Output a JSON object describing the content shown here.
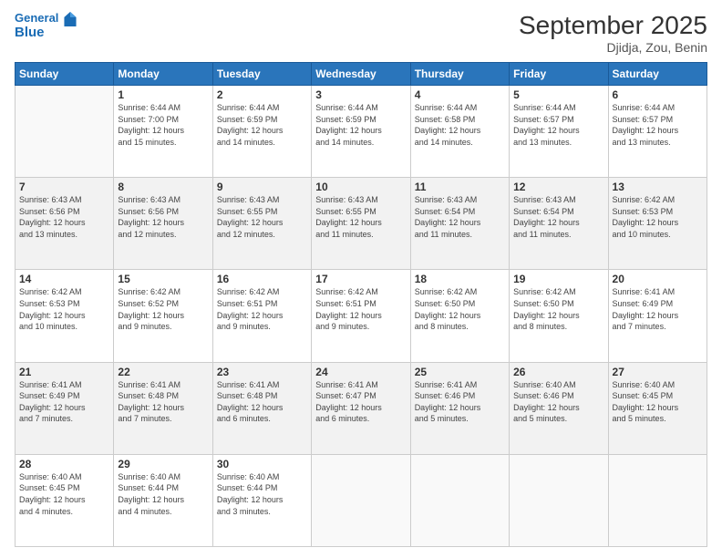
{
  "header": {
    "logo_line1": "General",
    "logo_line2": "Blue",
    "month_title": "September 2025",
    "location": "Djidja, Zou, Benin"
  },
  "weekdays": [
    "Sunday",
    "Monday",
    "Tuesday",
    "Wednesday",
    "Thursday",
    "Friday",
    "Saturday"
  ],
  "weeks": [
    [
      {
        "day": "",
        "info": ""
      },
      {
        "day": "1",
        "info": "Sunrise: 6:44 AM\nSunset: 7:00 PM\nDaylight: 12 hours\nand 15 minutes."
      },
      {
        "day": "2",
        "info": "Sunrise: 6:44 AM\nSunset: 6:59 PM\nDaylight: 12 hours\nand 14 minutes."
      },
      {
        "day": "3",
        "info": "Sunrise: 6:44 AM\nSunset: 6:59 PM\nDaylight: 12 hours\nand 14 minutes."
      },
      {
        "day": "4",
        "info": "Sunrise: 6:44 AM\nSunset: 6:58 PM\nDaylight: 12 hours\nand 14 minutes."
      },
      {
        "day": "5",
        "info": "Sunrise: 6:44 AM\nSunset: 6:57 PM\nDaylight: 12 hours\nand 13 minutes."
      },
      {
        "day": "6",
        "info": "Sunrise: 6:44 AM\nSunset: 6:57 PM\nDaylight: 12 hours\nand 13 minutes."
      }
    ],
    [
      {
        "day": "7",
        "info": "Sunrise: 6:43 AM\nSunset: 6:56 PM\nDaylight: 12 hours\nand 13 minutes."
      },
      {
        "day": "8",
        "info": "Sunrise: 6:43 AM\nSunset: 6:56 PM\nDaylight: 12 hours\nand 12 minutes."
      },
      {
        "day": "9",
        "info": "Sunrise: 6:43 AM\nSunset: 6:55 PM\nDaylight: 12 hours\nand 12 minutes."
      },
      {
        "day": "10",
        "info": "Sunrise: 6:43 AM\nSunset: 6:55 PM\nDaylight: 12 hours\nand 11 minutes."
      },
      {
        "day": "11",
        "info": "Sunrise: 6:43 AM\nSunset: 6:54 PM\nDaylight: 12 hours\nand 11 minutes."
      },
      {
        "day": "12",
        "info": "Sunrise: 6:43 AM\nSunset: 6:54 PM\nDaylight: 12 hours\nand 11 minutes."
      },
      {
        "day": "13",
        "info": "Sunrise: 6:42 AM\nSunset: 6:53 PM\nDaylight: 12 hours\nand 10 minutes."
      }
    ],
    [
      {
        "day": "14",
        "info": "Sunrise: 6:42 AM\nSunset: 6:53 PM\nDaylight: 12 hours\nand 10 minutes."
      },
      {
        "day": "15",
        "info": "Sunrise: 6:42 AM\nSunset: 6:52 PM\nDaylight: 12 hours\nand 9 minutes."
      },
      {
        "day": "16",
        "info": "Sunrise: 6:42 AM\nSunset: 6:51 PM\nDaylight: 12 hours\nand 9 minutes."
      },
      {
        "day": "17",
        "info": "Sunrise: 6:42 AM\nSunset: 6:51 PM\nDaylight: 12 hours\nand 9 minutes."
      },
      {
        "day": "18",
        "info": "Sunrise: 6:42 AM\nSunset: 6:50 PM\nDaylight: 12 hours\nand 8 minutes."
      },
      {
        "day": "19",
        "info": "Sunrise: 6:42 AM\nSunset: 6:50 PM\nDaylight: 12 hours\nand 8 minutes."
      },
      {
        "day": "20",
        "info": "Sunrise: 6:41 AM\nSunset: 6:49 PM\nDaylight: 12 hours\nand 7 minutes."
      }
    ],
    [
      {
        "day": "21",
        "info": "Sunrise: 6:41 AM\nSunset: 6:49 PM\nDaylight: 12 hours\nand 7 minutes."
      },
      {
        "day": "22",
        "info": "Sunrise: 6:41 AM\nSunset: 6:48 PM\nDaylight: 12 hours\nand 7 minutes."
      },
      {
        "day": "23",
        "info": "Sunrise: 6:41 AM\nSunset: 6:48 PM\nDaylight: 12 hours\nand 6 minutes."
      },
      {
        "day": "24",
        "info": "Sunrise: 6:41 AM\nSunset: 6:47 PM\nDaylight: 12 hours\nand 6 minutes."
      },
      {
        "day": "25",
        "info": "Sunrise: 6:41 AM\nSunset: 6:46 PM\nDaylight: 12 hours\nand 5 minutes."
      },
      {
        "day": "26",
        "info": "Sunrise: 6:40 AM\nSunset: 6:46 PM\nDaylight: 12 hours\nand 5 minutes."
      },
      {
        "day": "27",
        "info": "Sunrise: 6:40 AM\nSunset: 6:45 PM\nDaylight: 12 hours\nand 5 minutes."
      }
    ],
    [
      {
        "day": "28",
        "info": "Sunrise: 6:40 AM\nSunset: 6:45 PM\nDaylight: 12 hours\nand 4 minutes."
      },
      {
        "day": "29",
        "info": "Sunrise: 6:40 AM\nSunset: 6:44 PM\nDaylight: 12 hours\nand 4 minutes."
      },
      {
        "day": "30",
        "info": "Sunrise: 6:40 AM\nSunset: 6:44 PM\nDaylight: 12 hours\nand 3 minutes."
      },
      {
        "day": "",
        "info": ""
      },
      {
        "day": "",
        "info": ""
      },
      {
        "day": "",
        "info": ""
      },
      {
        "day": "",
        "info": ""
      }
    ]
  ]
}
